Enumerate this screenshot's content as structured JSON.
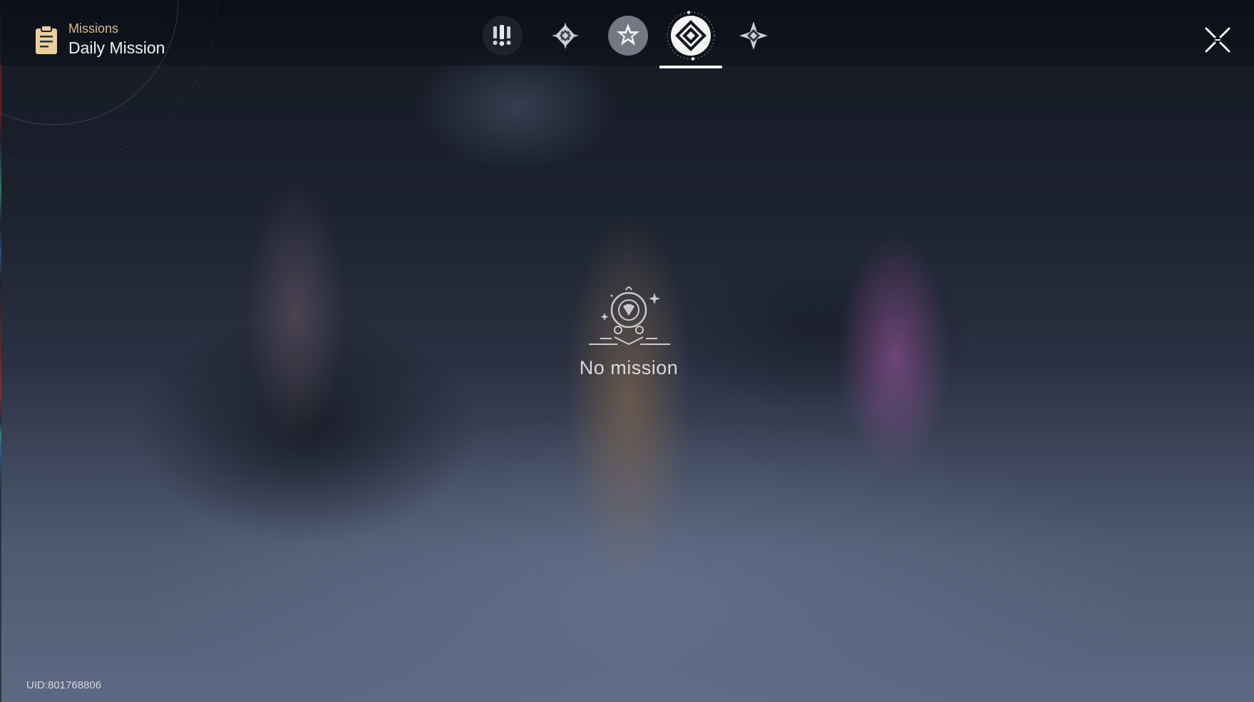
{
  "header": {
    "section_label": "Missions",
    "page_title": "Daily Mission"
  },
  "tabs": [
    {
      "name": "urgent-missions",
      "icon": "double-exclamation-icon",
      "active": false
    },
    {
      "name": "trailblaze-missions",
      "icon": "compass-star-icon",
      "active": false
    },
    {
      "name": "companion-missions",
      "icon": "star-badge-icon",
      "active": false
    },
    {
      "name": "daily-missions",
      "icon": "diamond-ring-icon",
      "active": true
    },
    {
      "name": "adventure-missions",
      "icon": "four-point-star-icon",
      "active": false
    }
  ],
  "empty_state": {
    "message": "No mission",
    "icon": "empty-mission-icon"
  },
  "footer": {
    "uid": "UID:801768806"
  },
  "colors": {
    "accent_gold": "#d9bb86",
    "active_tab_bg": "#f5f5f5",
    "text_light": "#f2f2f2"
  }
}
